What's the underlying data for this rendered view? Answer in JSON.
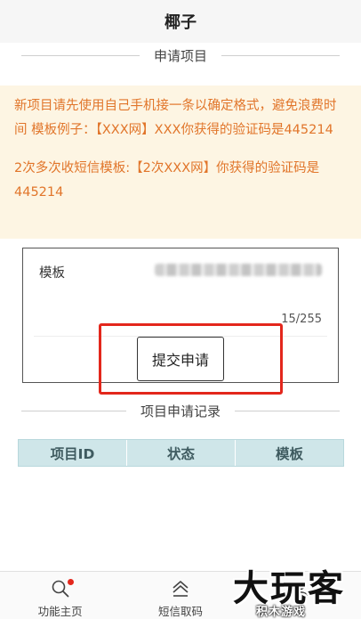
{
  "header": {
    "title": "椰子"
  },
  "section_apply": {
    "title": "申请项目"
  },
  "notice": {
    "para1": "新项目请先使用自己手机接一条以确定格式，避免浪费时间 模板例子：【XXX网】XXX你获得的验证码是445214",
    "para2": "2次多次收短信模板:【2次XXX网】你获得的验证码是445214"
  },
  "form": {
    "template_label": "模板",
    "char_count": "15/255",
    "submit_label": "提交申请"
  },
  "section_records": {
    "title": "项目申请记录"
  },
  "records_table": {
    "columns": [
      "项目ID",
      "状态",
      "模板"
    ]
  },
  "tabbar": {
    "items": [
      {
        "label": "功能主页",
        "icon": "search-icon",
        "badge": true
      },
      {
        "label": "短信取码",
        "icon": "home-icon",
        "badge": false
      },
      {
        "label": "",
        "icon": "user-icon",
        "badge": false
      }
    ]
  },
  "watermark": {
    "main": "大玩客",
    "sub": "积木游戏"
  },
  "colors": {
    "notice_text": "#e1752a",
    "notice_bg": "#fdf5e3",
    "highlight": "#e3271c",
    "table_header": "#cfe6e9"
  }
}
